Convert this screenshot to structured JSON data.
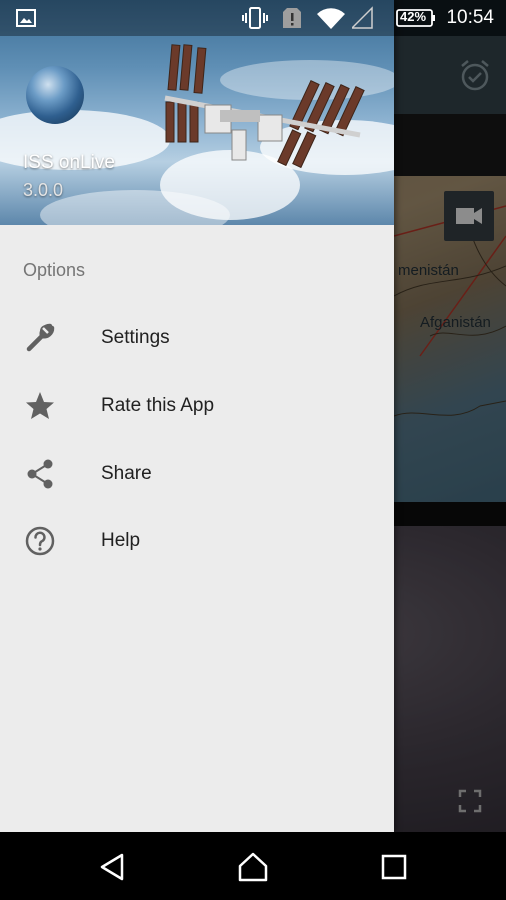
{
  "status_bar": {
    "time": "10:54",
    "battery_percent": "42%",
    "icons": [
      "image-icon",
      "vibrate-icon",
      "sim-alert-icon",
      "wifi-icon",
      "signal-icon",
      "battery-icon"
    ]
  },
  "background_app": {
    "map_labels": {
      "turkmenistan": "menistán",
      "afghanistan": "Afganistán"
    },
    "icons": [
      "alarm-check-icon",
      "video-camera-icon",
      "fullscreen-icon"
    ]
  },
  "drawer": {
    "header": {
      "app_name": "ISS onLive",
      "version": "3.0.0"
    },
    "section_title": "Options",
    "items": [
      {
        "label": "Settings",
        "icon": "wrench-icon"
      },
      {
        "label": "Rate this App",
        "icon": "star-icon"
      },
      {
        "label": "Share",
        "icon": "share-icon"
      },
      {
        "label": "Help",
        "icon": "help-icon"
      }
    ]
  },
  "nav_bar": {
    "buttons": [
      "back-icon",
      "home-icon",
      "recents-icon"
    ]
  },
  "colors": {
    "drawer_bg": "#ececec",
    "toolbar": "#37474f",
    "icon_gray": "#616161",
    "text_primary": "#212121",
    "text_secondary": "#757575"
  }
}
